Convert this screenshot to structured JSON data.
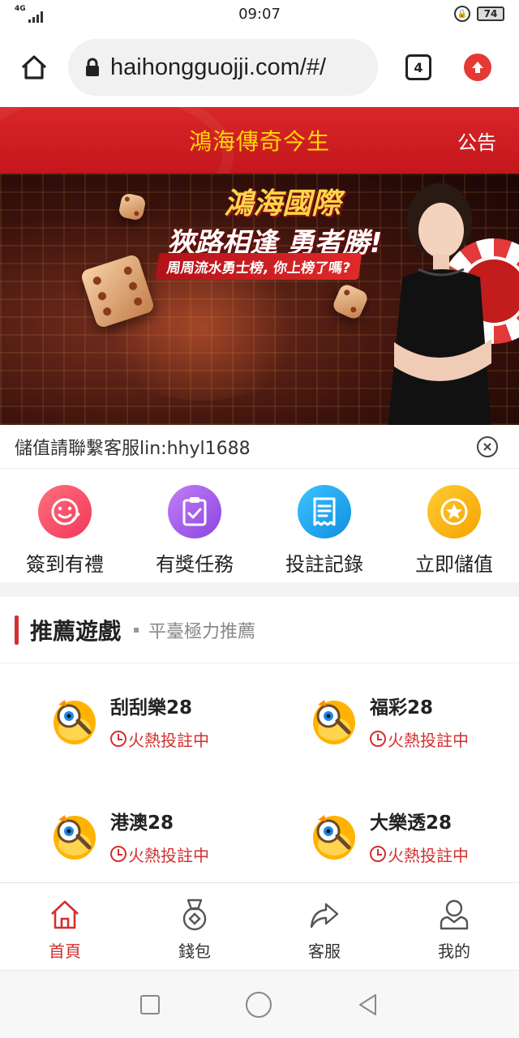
{
  "status_bar": {
    "network": "4G",
    "time": "09:07",
    "battery": "74"
  },
  "browser": {
    "url": "haihongguojji.com/#/",
    "tab_count": "4"
  },
  "header": {
    "title": "鴻海傳奇今生",
    "notice_label": "公告"
  },
  "banner": {
    "brand": "鴻海國際",
    "slogan": "狹路相逢 勇者勝!",
    "subtitle": "周周流水勇士榜, 你上榜了嗎?"
  },
  "notice": {
    "text": "儲值請聯繫客服lin:hhyl1688"
  },
  "quick_actions": [
    {
      "label": "簽到有禮",
      "icon": "smile-sign-icon",
      "color": "#f24b66"
    },
    {
      "label": "有獎任務",
      "icon": "clipboard-check-icon",
      "color": "#a05ee8"
    },
    {
      "label": "投註記錄",
      "icon": "receipt-icon",
      "color": "#1ea2ef"
    },
    {
      "label": "立即儲值",
      "icon": "star-coin-icon",
      "color": "#ffb300"
    }
  ],
  "section": {
    "title": "推薦遊戲",
    "subtitle": "平臺極力推薦"
  },
  "games": [
    {
      "name": "刮刮樂28",
      "status": "火熱投註中"
    },
    {
      "name": "福彩28",
      "status": "火熱投註中"
    },
    {
      "name": "港澳28",
      "status": "火熱投註中"
    },
    {
      "name": "大樂透28",
      "status": "火熱投註中"
    }
  ],
  "bottom_nav": [
    {
      "label": "首頁",
      "icon": "home-icon",
      "active": true
    },
    {
      "label": "錢包",
      "icon": "wallet-medal-icon",
      "active": false
    },
    {
      "label": "客服",
      "icon": "share-arrow-icon",
      "active": false
    },
    {
      "label": "我的",
      "icon": "user-icon",
      "active": false
    }
  ],
  "colors": {
    "brand_red": "#d32f2f",
    "header_title": "#ffd700"
  }
}
